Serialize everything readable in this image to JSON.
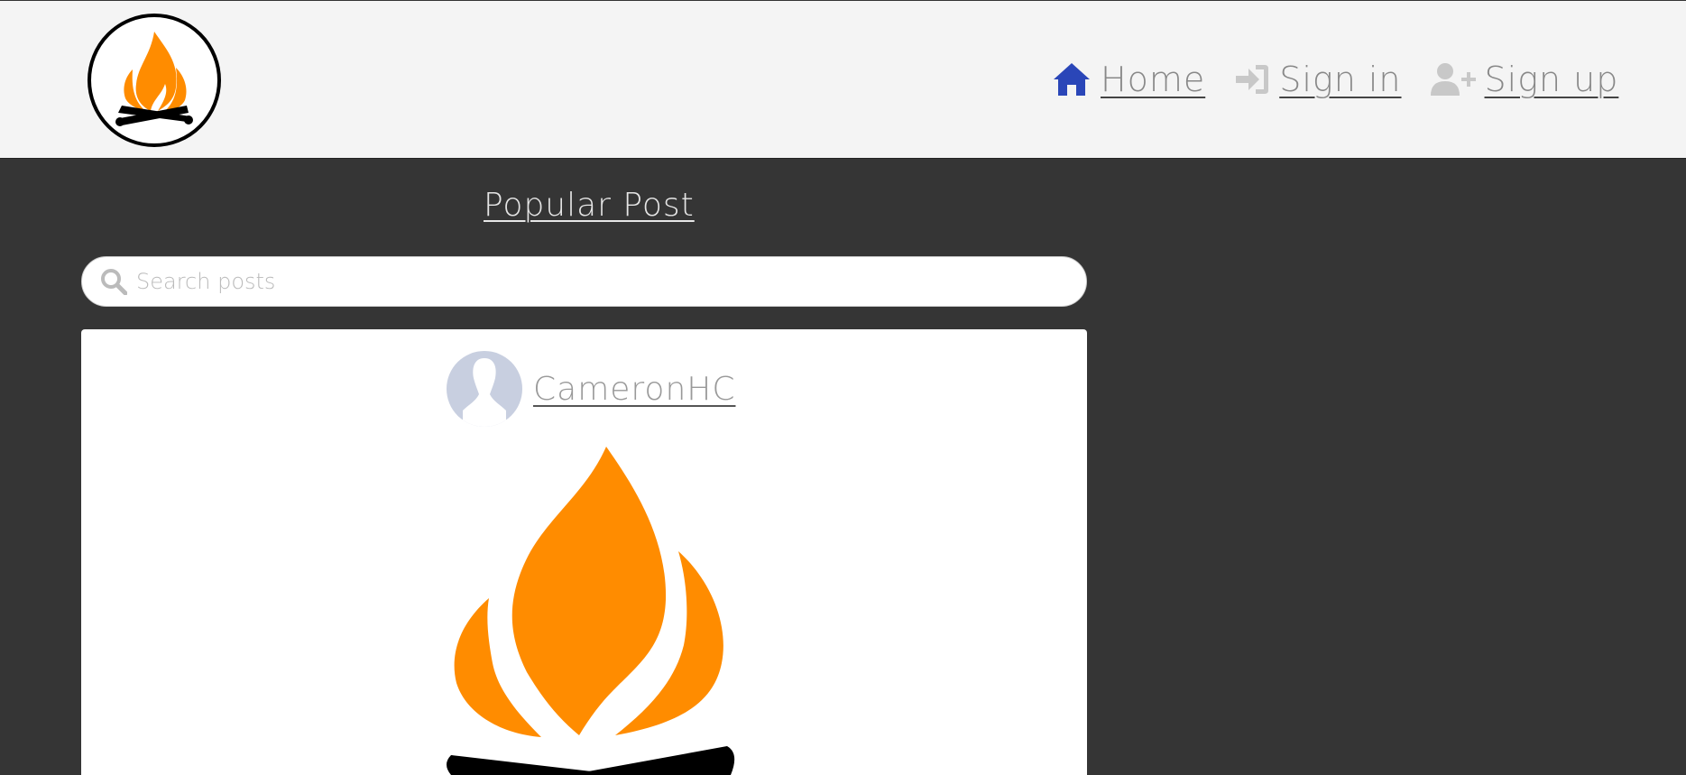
{
  "nav": {
    "home_label": "Home",
    "signin_label": "Sign in",
    "signup_label": "Sign up"
  },
  "main": {
    "title": "Popular Post"
  },
  "search": {
    "placeholder": "Search posts",
    "value": ""
  },
  "post": {
    "author": "CameronHC"
  },
  "colors": {
    "header_bg": "#f4f4f4",
    "page_bg": "#353535",
    "flame_orange": "#ff8c00",
    "home_icon": "#2a46b8",
    "muted_icon": "#c8c8c8",
    "avatar_bg": "#c8cfe0"
  },
  "icons": {
    "home": "home-icon",
    "signin": "sign-in-icon",
    "signup": "user-plus-icon",
    "search": "search-icon"
  }
}
